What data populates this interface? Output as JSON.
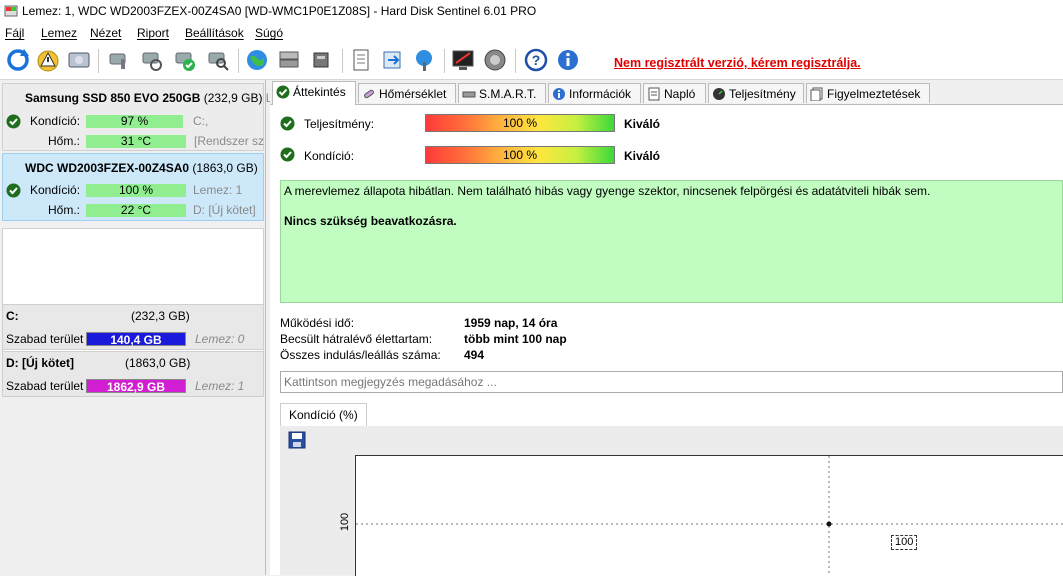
{
  "window": {
    "title": "Lemez: 1, WDC WD2003FZEX-00Z4SA0 [WD-WMC1P0E1Z08S]  -  Hard Disk Sentinel 6.01 PRO"
  },
  "menu": [
    "Fájl",
    "Lemez",
    "Nézet",
    "Riport",
    "Beállítások",
    "Súgó"
  ],
  "toolbar": {
    "unregistered_notice": "Nem regisztrált verzió, kérem regisztrálja."
  },
  "disks": [
    {
      "name": "Samsung SSD 850 EVO 250GB",
      "size": "(232,9 GB)",
      "extra": "Le",
      "condition_label": "Kondíció:",
      "condition_value": "97 %",
      "condition_pct": 97,
      "temp_label": "Hőm.:",
      "temp_value": "31 °C",
      "info1": "C:,",
      "info2": "[Rendszer szá"
    },
    {
      "name": "WDC WD2003FZEX-00Z4SA0",
      "size": "(1863,0 GB)",
      "condition_label": "Kondíció:",
      "condition_value": "100 %",
      "condition_pct": 100,
      "temp_label": "Hőm.:",
      "temp_value": "22 °C",
      "info1": "Lemez: 1",
      "info2": "D: [Új kötet]"
    }
  ],
  "volumes": [
    {
      "name": "C:",
      "size": "(232,3 GB)",
      "free_label": "Szabad terület",
      "free_value": "140,4 GB",
      "disk": "Lemez: 0",
      "bar_color": "#1a1adc"
    },
    {
      "name": "D: [Új kötet]",
      "size": "(1863,0 GB)",
      "free_label": "Szabad terület",
      "free_value": "1862,9 GB",
      "disk": "Lemez: 1",
      "bar_color": "#d21ed2"
    }
  ],
  "tabs": [
    "Áttekintés",
    "Hőmérséklet",
    "S.M.A.R.T.",
    "Információk",
    "Napló",
    "Teljesítmény",
    "Figyelmeztetések"
  ],
  "overview": {
    "performance_label": "Teljesítmény:",
    "performance_value": "100 %",
    "performance_rating": "Kiváló",
    "condition_label": "Kondíció:",
    "condition_value": "100 %",
    "condition_rating": "Kiváló",
    "message_line1": "A merevlemez állapota hibátlan. Nem található hibás vagy gyenge szektor, nincsenek felpörgési és adatátviteli hibák sem.",
    "message_line2": "Nincs szükség beavatkozásra.",
    "uptime_label": "Működési idő:",
    "uptime_value": "1959 nap, 14 óra",
    "lifetime_label": "Becsült hátralévő élettartam:",
    "lifetime_value": "több mint 100 nap",
    "startstop_label": "Összes indulás/leállás száma:",
    "startstop_value": "494",
    "note_placeholder": "Kattintson megjegyzés megadásához ..."
  },
  "chart_tab": "Kondíció  (%)",
  "chart_data": {
    "type": "line",
    "title": "",
    "ytick_labels": [
      "100"
    ],
    "series": [
      {
        "values": [
          100
        ]
      }
    ],
    "data_labels": [
      "100"
    ],
    "grid": true
  }
}
